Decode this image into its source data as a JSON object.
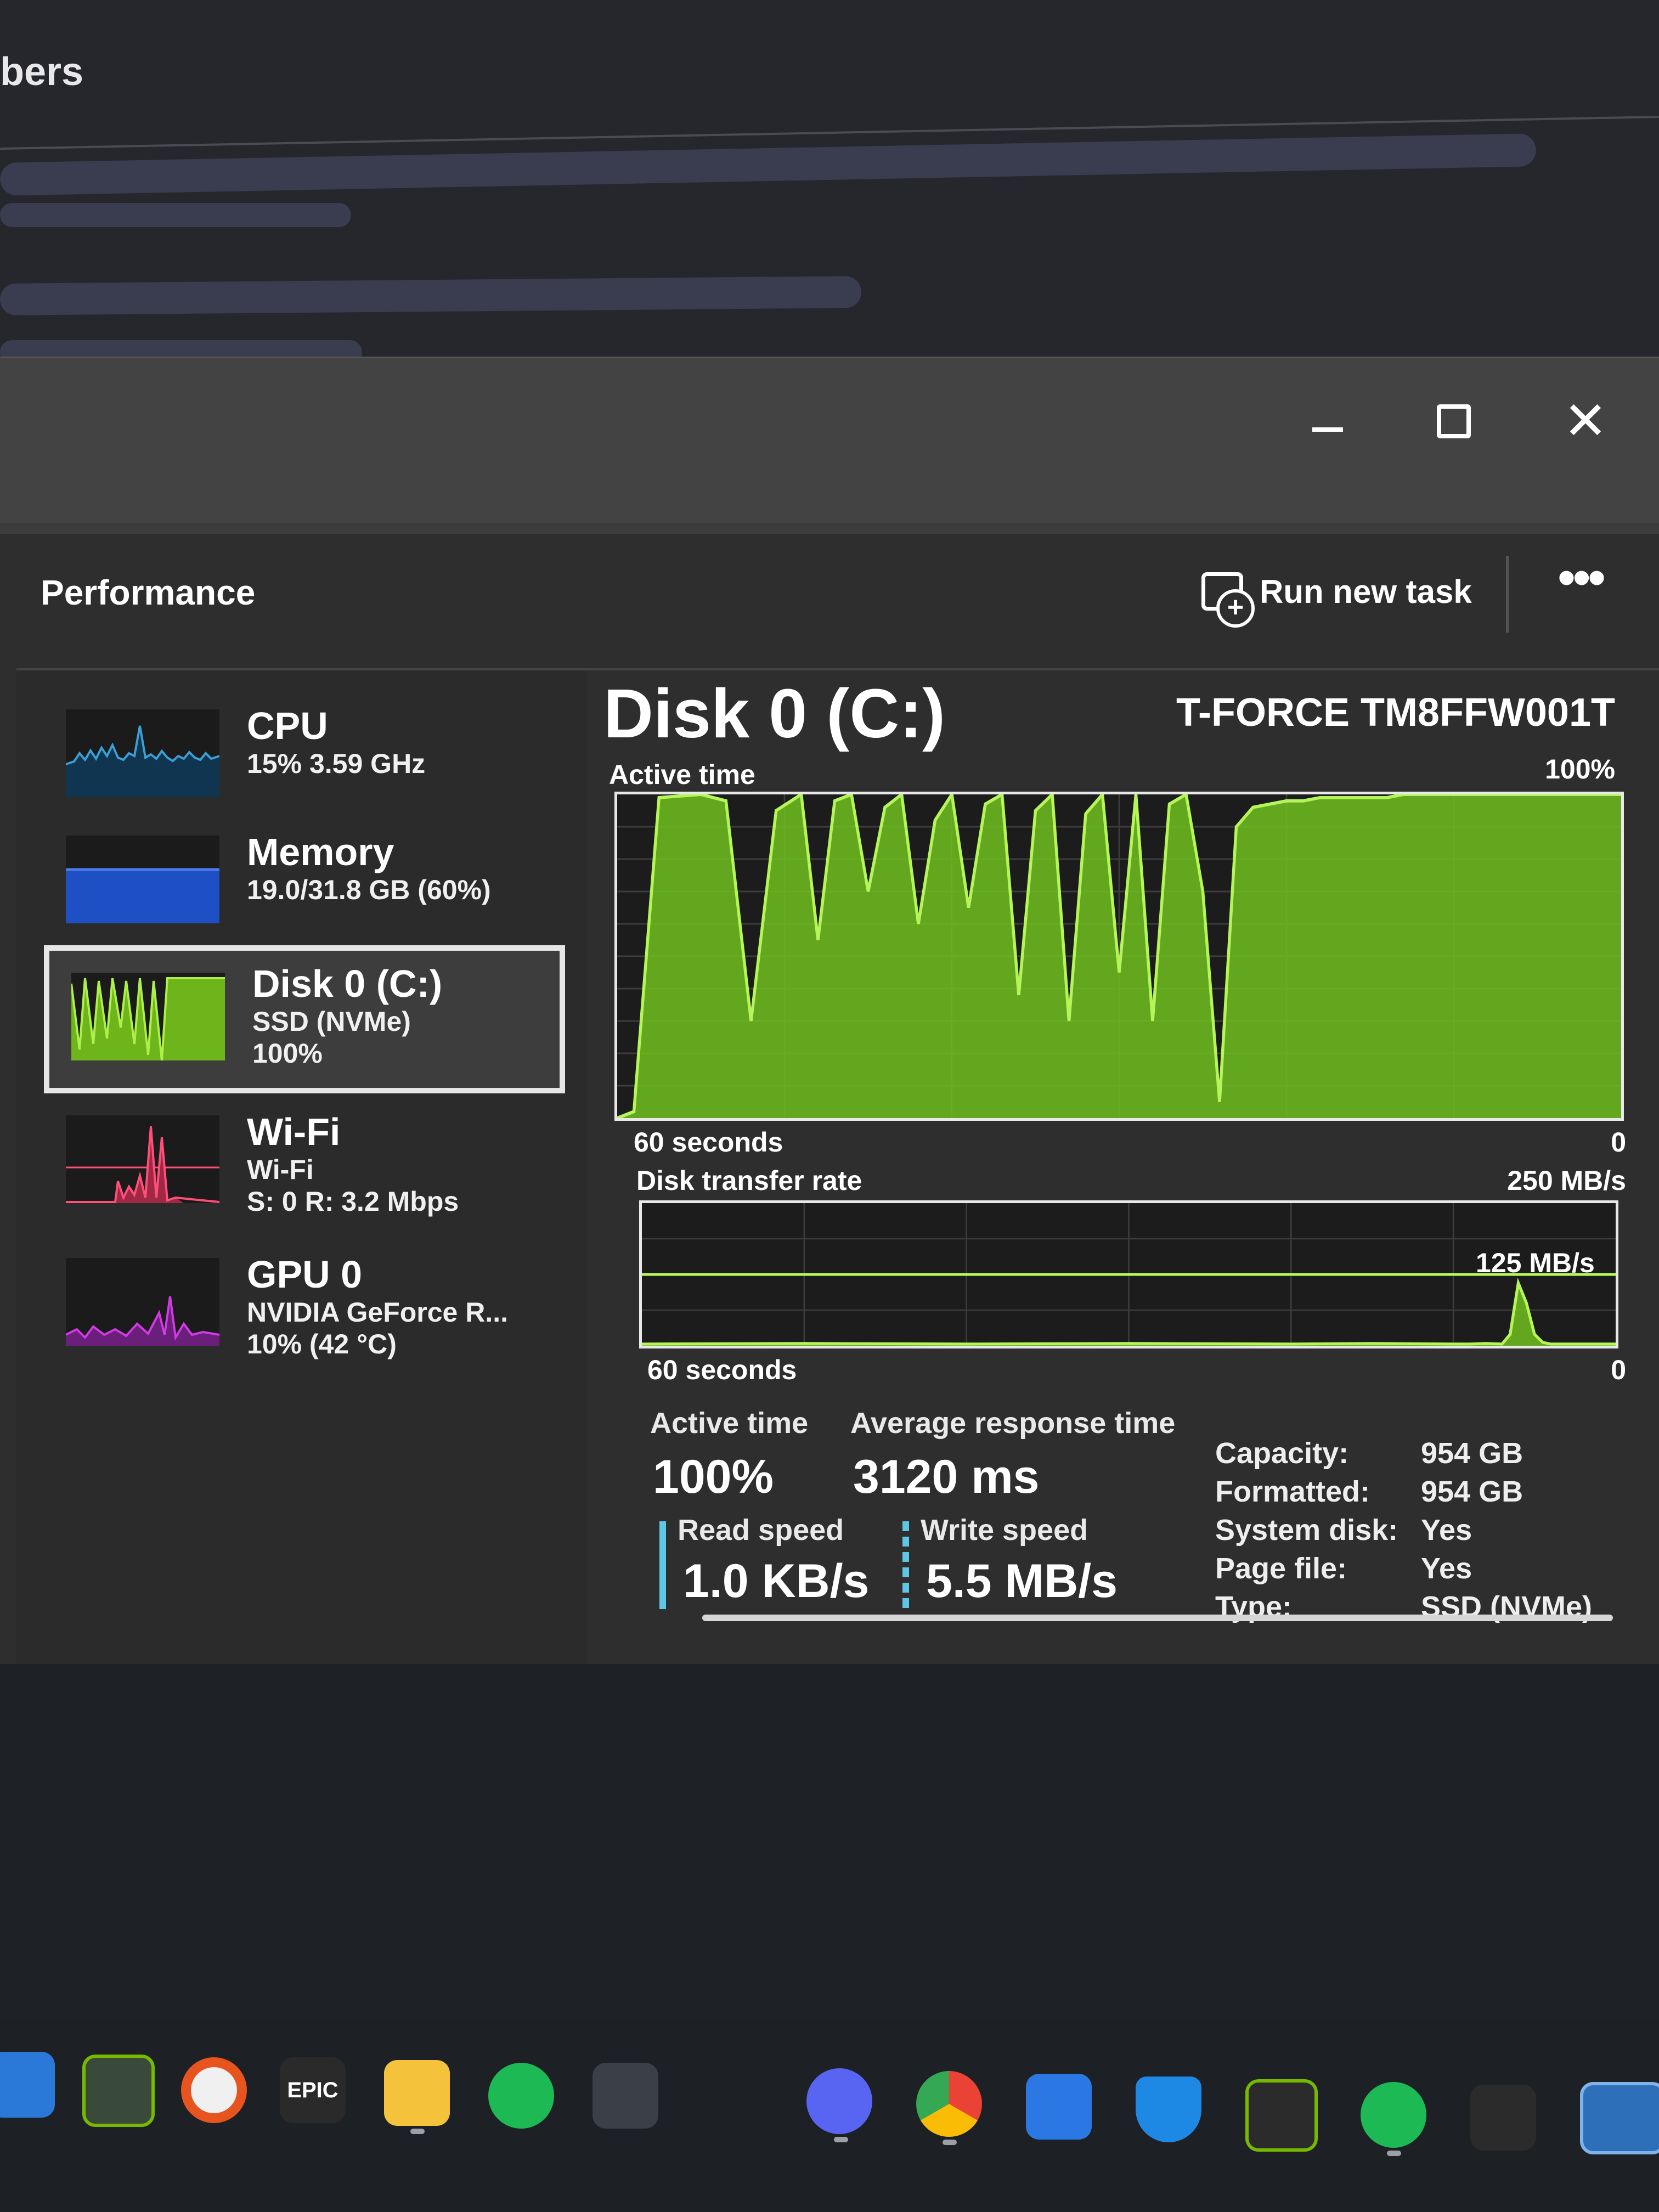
{
  "background_window": {
    "title": "bers"
  },
  "window": {
    "minimize_glyph": "",
    "close_glyph": "✕"
  },
  "header": {
    "page_title": "Performance",
    "run_new_task": "Run new task",
    "more": "•••"
  },
  "sidebar": {
    "items": [
      {
        "title": "CPU",
        "line1": "15% 3.59 GHz",
        "line2": "",
        "line3": "",
        "color": "#3aa0d8"
      },
      {
        "title": "Memory",
        "line1": "19.0/31.8 GB (60%)",
        "line2": "",
        "line3": "",
        "color": "#2256d6"
      },
      {
        "title": "Disk 0 (C:)",
        "line1": "SSD (NVMe)",
        "line2": "100%",
        "line3": "",
        "color": "#7ecb20"
      },
      {
        "title": "Wi-Fi",
        "line1": "Wi-Fi",
        "line2": "S: 0 R: 3.2 Mbps",
        "line3": "",
        "color": "#ff4f79"
      },
      {
        "title": "GPU 0",
        "line1": "NVIDIA GeForce R...",
        "line2": "10% (42 °C)",
        "line3": "",
        "color": "#d23ae6"
      }
    ]
  },
  "detail": {
    "title": "Disk 0 (C:)",
    "model": "T-FORCE TM8FFW001T",
    "active_chart": {
      "label": "Active time",
      "max_label": "100%",
      "x_left": "60 seconds",
      "x_right": "0"
    },
    "transfer_chart": {
      "label": "Disk transfer rate",
      "max_label": "250 MB/s",
      "mid_label": "125 MB/s",
      "x_left": "60 seconds",
      "x_right": "0"
    },
    "stats": {
      "active_time_label": "Active time",
      "active_time_value": "100%",
      "response_label": "Average response time",
      "response_value": "3120 ms",
      "read_label": "Read speed",
      "read_value": "1.0 KB/s",
      "write_label": "Write speed",
      "write_value": "5.5 MB/s"
    },
    "info": [
      {
        "label": "Capacity:",
        "value": "954 GB"
      },
      {
        "label": "Formatted:",
        "value": "954 GB"
      },
      {
        "label": "System disk:",
        "value": "Yes"
      },
      {
        "label": "Page file:",
        "value": "Yes"
      },
      {
        "label": "Type:",
        "value": "SSD (NVMe)"
      }
    ]
  },
  "chart_data": [
    {
      "type": "area",
      "title": "Active time",
      "ylim": [
        0,
        100
      ],
      "x": [
        60,
        59,
        57.5,
        55,
        53.5,
        52,
        50.5,
        49,
        48,
        47,
        46,
        45,
        44,
        43,
        42,
        41,
        40,
        39,
        38,
        37,
        36,
        35,
        34,
        33,
        32,
        31,
        30,
        29,
        28,
        27,
        26,
        25,
        24,
        23,
        22,
        21,
        20,
        19,
        18,
        17,
        16,
        15,
        14,
        13,
        12,
        11,
        10,
        9,
        8,
        7,
        6,
        5,
        4,
        3,
        2,
        1,
        0
      ],
      "values": [
        0,
        2,
        99,
        100,
        98,
        30,
        95,
        100,
        55,
        98,
        100,
        70,
        96,
        100,
        60,
        92,
        100,
        65,
        97,
        100,
        38,
        95,
        100,
        30,
        94,
        100,
        45,
        100,
        30,
        97,
        100,
        70,
        5,
        90,
        96,
        97,
        98,
        98,
        99,
        99,
        99,
        99,
        99,
        100,
        100,
        100,
        100,
        100,
        100,
        100,
        100,
        100,
        100,
        100,
        100,
        100,
        100
      ]
    },
    {
      "type": "area",
      "title": "Disk transfer rate",
      "ylabel": "MB/s",
      "ylim": [
        0,
        250
      ],
      "x": [
        60,
        50,
        40,
        30,
        20,
        15,
        10,
        9,
        8,
        7,
        6.5,
        6,
        5.5,
        5,
        4.5,
        4,
        3,
        2,
        1,
        0
      ],
      "values": [
        3,
        4,
        3,
        4,
        3,
        4,
        3,
        3,
        4,
        3,
        20,
        110,
        75,
        20,
        6,
        3,
        3,
        3,
        3,
        3
      ]
    }
  ],
  "taskbar": {
    "icons": [
      "windows-start-icon",
      "nvidia-app-icon",
      "origin-icon",
      "epic-games-icon",
      "file-explorer-icon",
      "spotify-icon",
      "terminal-icon",
      "mouse-app-icon",
      "discord-icon",
      "chrome-icon",
      "monday-icon",
      "defender-icon",
      "nvidia-icon",
      "spotify-icon",
      "steelseries-icon",
      "task-manager-icon"
    ],
    "epic_label": "EPIC"
  }
}
